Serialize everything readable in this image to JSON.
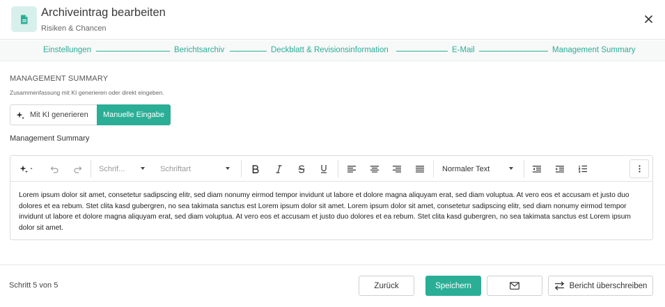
{
  "header": {
    "title": "Archiveintrag bearbeiten",
    "subtitle": "Risiken & Chancen",
    "icon": "document-icon",
    "close_icon": "close-icon"
  },
  "stepper": {
    "steps": [
      "Einstellungen",
      "Berichtsarchiv",
      "Deckblatt & Revisionsinformation",
      "E-Mail",
      "Management Summary"
    ],
    "accent_color": "#2bae96"
  },
  "section": {
    "title": "MANAGEMENT SUMMARY",
    "description": "Zusammenfassung mit KI generieren oder direkt eingeben."
  },
  "toggle": {
    "ki_label": "Mit KI generieren",
    "manual_label": "Manuelle Eingabe",
    "selected": "Manuelle Eingabe"
  },
  "field": {
    "label": "Management Summary"
  },
  "toolbar": {
    "font_size_placeholder": "Schrif...",
    "font_family_placeholder": "Schriftart",
    "paragraph_style": "Normaler Text",
    "icons": [
      "sparkle-icon",
      "undo-icon",
      "redo-icon",
      "bold-icon",
      "italic-icon",
      "strikethrough-icon",
      "underline-icon",
      "align-left-icon",
      "align-center-icon",
      "align-right-icon",
      "align-justify-icon",
      "outdent-icon",
      "indent-icon",
      "numbered-list-icon",
      "more-vertical-icon"
    ]
  },
  "editor": {
    "text": "Lorem ipsum dolor sit amet, consetetur sadipscing elitr, sed diam nonumy eirmod tempor invidunt ut labore et dolore magna aliquyam erat, sed diam voluptua. At vero eos et accusam et justo duo dolores et ea rebum. Stet clita kasd gubergren, no sea takimata sanctus est Lorem ipsum dolor sit amet. Lorem ipsum dolor sit amet, consetetur sadipscing elitr, sed diam nonumy eirmod tempor invidunt ut labore et dolore magna aliquyam erat, sed diam voluptua. At vero eos et accusam et justo duo dolores et ea rebum. Stet clita kasd gubergren, no sea takimata sanctus est Lorem ipsum dolor sit amet."
  },
  "footer": {
    "step_text": "Schritt 5 von 5",
    "back_label": "Zurück",
    "save_label": "Speichern",
    "mail_icon": "mail-icon",
    "overwrite_label": "Bericht überschreiben"
  }
}
